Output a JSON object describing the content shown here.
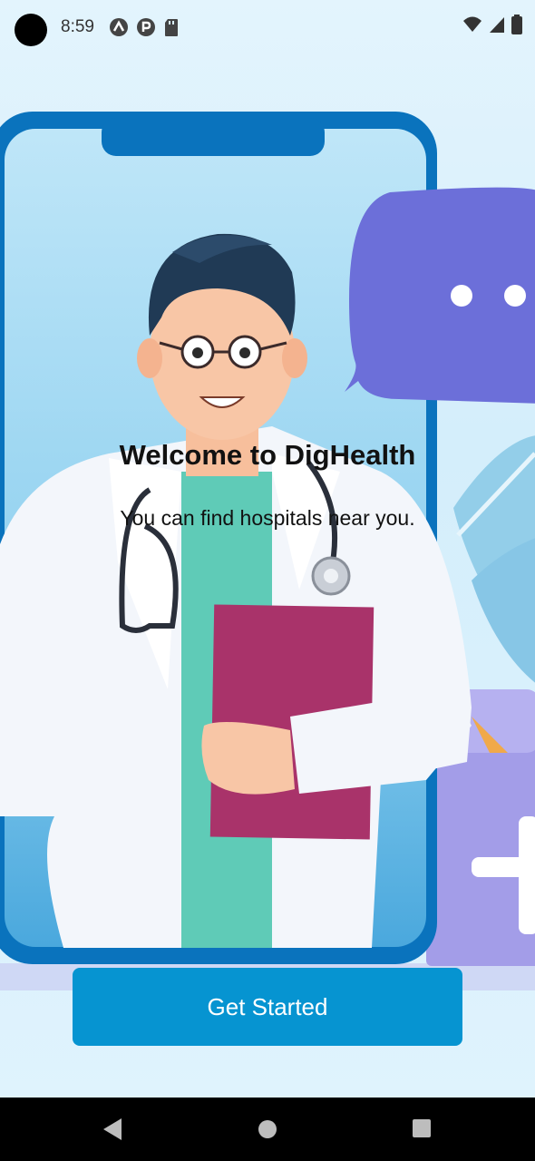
{
  "status_bar": {
    "time": "8:59",
    "left_icons": [
      "notification-a-icon",
      "notification-p-icon",
      "sd-card-icon"
    ],
    "right_icons": [
      "wifi-icon",
      "signal-icon",
      "battery-icon"
    ]
  },
  "welcome": {
    "title": "Welcome to DigHealth",
    "subtitle": "You can find hospitals near you."
  },
  "cta": {
    "label": "Get Started"
  },
  "nav_bar": {
    "buttons": [
      "back-icon",
      "home-icon",
      "recents-icon"
    ]
  },
  "colors": {
    "accent": "#0694d1",
    "phone_frame": "#0a73bd",
    "speech_bubble": "#6c6fd9",
    "clipboard": "#a9336a"
  }
}
